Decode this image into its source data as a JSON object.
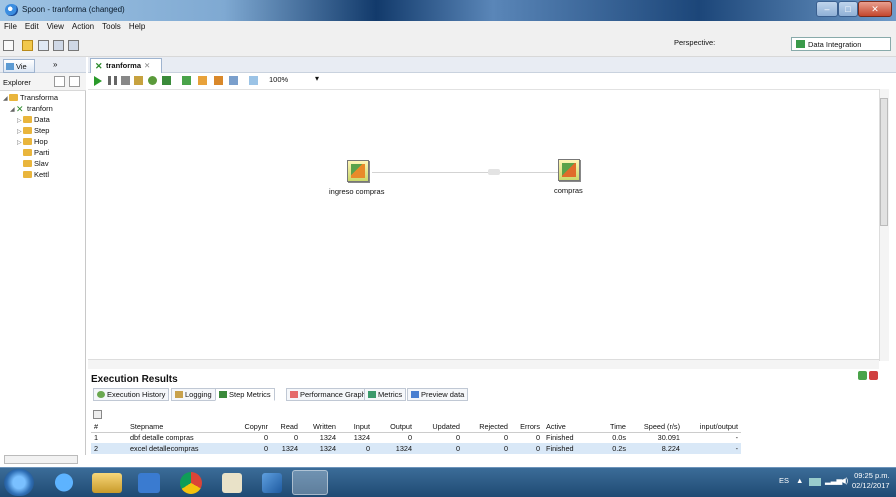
{
  "window": {
    "title": "Spoon - tranforma (changed)"
  },
  "menu": [
    "File",
    "Edit",
    "View",
    "Action",
    "Tools",
    "Help"
  ],
  "perspective": {
    "label": "Perspective:",
    "value": "Data Integration"
  },
  "left_panel": {
    "view_tab": "Vie",
    "chevron_label": "»",
    "explorer_label": "Explorer",
    "tree": [
      {
        "label": "Transforma",
        "level": 0,
        "expanded": true
      },
      {
        "label": "tranforn",
        "level": 1,
        "expanded": true
      },
      {
        "label": "Data",
        "level": 2,
        "expanded": false
      },
      {
        "label": "Step",
        "level": 2,
        "expanded": false
      },
      {
        "label": "Hop",
        "level": 2,
        "expanded": false
      },
      {
        "label": "Parti",
        "level": 2,
        "expanded": false
      },
      {
        "label": "Slav",
        "level": 2,
        "expanded": false
      },
      {
        "label": "Kettl",
        "level": 2,
        "expanded": false
      }
    ]
  },
  "editor": {
    "tab_label": "tranforma",
    "zoom": "100%",
    "steps": [
      {
        "name": "ingreso compras",
        "icon": "table-input-icon"
      },
      {
        "name": "compras",
        "icon": "excel-output-icon"
      }
    ]
  },
  "results": {
    "title": "Execution Results",
    "tabs": [
      "Execution History",
      "Logging",
      "Step Metrics",
      "Performance Graph",
      "Metrics",
      "Preview data"
    ],
    "active_tab": "Step Metrics",
    "columns": [
      "#",
      "Stepname",
      "Copynr",
      "Read",
      "Written",
      "Input",
      "Output",
      "Updated",
      "Rejected",
      "Errors",
      "Active",
      "Time",
      "Speed (r/s)",
      "input/output"
    ],
    "rows": [
      [
        "1",
        "dbf detalle compras",
        "0",
        "0",
        "1324",
        "1324",
        "0",
        "0",
        "0",
        "0",
        "Finished",
        "0.0s",
        "30.091",
        "-"
      ],
      [
        "2",
        "excel detallecompras",
        "0",
        "1324",
        "1324",
        "0",
        "1324",
        "0",
        "0",
        "0",
        "Finished",
        "0.2s",
        "8.224",
        "-"
      ]
    ]
  },
  "taskbar": {
    "language": "ES",
    "time": "09:25 p.m.",
    "date": "02/12/2017"
  }
}
